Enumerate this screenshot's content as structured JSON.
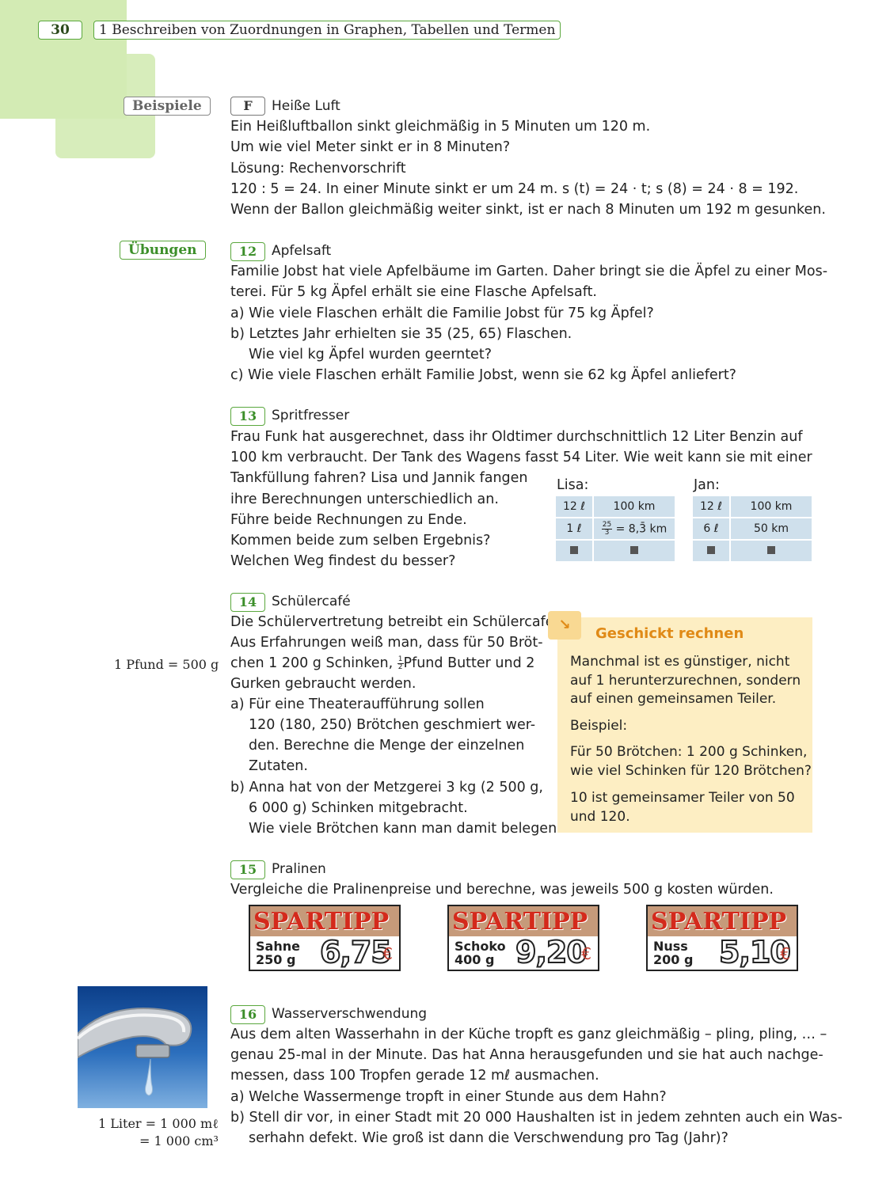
{
  "header": {
    "page_number": "30",
    "chapter_title": "1 Beschreiben von Zuordnungen in Graphen, Tabellen und Termen"
  },
  "tags": {
    "examples": "Beispiele",
    "exercises": "Übungen"
  },
  "example_f": {
    "label": "F",
    "title": "Heiße Luft",
    "lines": [
      "Ein Heißluftballon sinkt gleichmäßig in 5 Minuten um 120 m.",
      "Um wie viel Meter sinkt er in 8 Minuten?",
      "Lösung: Rechenvorschrift",
      "120 : 5 = 24. In einer Minute sinkt er um 24 m. s (t) = 24 · t; s (8) = 24 · 8 = 192.",
      "Wenn der Ballon gleichmäßig weiter sinkt, ist er nach 8 Minuten um 192 m gesunken."
    ]
  },
  "task12": {
    "number": "12",
    "title": "Apfelsaft",
    "lines": [
      "Familie Jobst hat viele Apfelbäume im Garten. Daher bringt sie die Äpfel zu einer Mos-",
      "terei. Für 5 kg Äpfel erhält sie eine Flasche Apfelsaft.",
      "a) Wie viele Flaschen erhält die Familie Jobst für 75 kg Äpfel?",
      "b) Letztes Jahr erhielten sie 35 (25, 65) Flaschen.",
      "Wie viel kg Äpfel wurden geerntet?",
      "c) Wie viele Flaschen erhält Familie Jobst, wenn sie 62 kg Äpfel anliefert?"
    ]
  },
  "task13": {
    "number": "13",
    "title": "Spritfresser",
    "lines": [
      "Frau Funk hat ausgerechnet, dass ihr Oldtimer durchschnittlich 12 Liter Benzin auf",
      "100 km verbraucht. Der Tank des Wagens fasst 54 Liter. Wie weit kann sie mit einer",
      "Tankfüllung fahren? Lisa und Jannik fangen",
      "ihre Berechnungen unterschiedlich an.",
      "Führe beide Rechnungen zu Ende.",
      "Kommen beide zum selben Ergebnis?",
      "Welchen Weg findest du besser?"
    ],
    "lisa": {
      "label": "Lisa:",
      "row1": [
        "12 ℓ",
        "100 km"
      ],
      "row2_left": "1 ℓ",
      "row2_frac_num": "25",
      "row2_frac_den": "3",
      "row2_rest": "= 8,3̄ km"
    },
    "jan": {
      "label": "Jan:",
      "row1": [
        "12 ℓ",
        "100 km"
      ],
      "row2": [
        "6 ℓ",
        "50 km"
      ]
    }
  },
  "task14": {
    "number": "14",
    "title": "Schülercafé",
    "side_note": "1 Pfund = 500 g",
    "line1": "Die Schülervertretung betreibt ein Schülercafé.",
    "line2": "Aus Erfahrungen weiß man, dass für 50 Bröt-",
    "line3_a": "chen 1 200 g Schinken,",
    "line3_frac_num": "1",
    "line3_frac_den": "2",
    "line3_b": "Pfund Butter und 2",
    "line4": "Gurken gebraucht werden.",
    "parts": [
      "a) Für eine Theateraufführung sollen",
      "120 (180, 250) Brötchen geschmiert wer-",
      "den. Berechne die Menge der einzelnen",
      "Zutaten.",
      "b) Anna hat von der Metzgerei 3 kg (2 500 g,",
      "6 000 g) Schinken mitgebracht.",
      "Wie viele Brötchen kann man damit belegen?"
    ]
  },
  "tip_box": {
    "arrow": "↘",
    "heading": "Geschickt rechnen",
    "lines": [
      "Manchmal ist es günstiger, nicht",
      "auf 1 herunterzurechnen, sondern",
      "auf einen gemeinsamen Teiler.",
      "Beispiel:",
      "Für 50 Brötchen: 1 200 g Schinken,",
      "wie viel Schinken für 120 Brötchen?",
      "10 ist gemeinsamer Teiler von 50",
      "und 120."
    ]
  },
  "task15": {
    "number": "15",
    "title": "Pralinen",
    "line": "Vergleiche die Pralinenpreise und berechne, was jeweils 500 g kosten würden.",
    "offers": [
      {
        "banner": "SPARTIPP",
        "name": "Sahne",
        "weight": "250 g",
        "price": "6,75",
        "currency": "€"
      },
      {
        "banner": "SPARTIPP",
        "name": "Schoko",
        "weight": "400 g",
        "price": "9,20",
        "currency": "€"
      },
      {
        "banner": "SPARTIPP",
        "name": "Nuss",
        "weight": "200 g",
        "price": "5,10",
        "currency": "€"
      }
    ]
  },
  "task16": {
    "number": "16",
    "title": "Wasserverschwendung",
    "side_note_1": "1 Liter = 1 000 mℓ",
    "side_note_2": "= 1 000 cm³",
    "lines": [
      "Aus dem alten Wasserhahn in der Küche tropft es ganz gleichmäßig – pling, pling, … –",
      "genau 25-mal in der Minute. Das hat Anna herausgefunden und sie hat auch nachge-",
      "messen, dass 100 Tropfen gerade 12 mℓ ausmachen.",
      "a) Welche Wassermenge tropft in einer Stunde aus dem Hahn?",
      "b) Stell dir vor, in einer Stadt mit 20 000 Haushalten ist in jedem zehnten auch ein Was-",
      "serhahn defekt. Wie groß ist dann die Verschwendung pro Tag (Jahr)?"
    ]
  }
}
